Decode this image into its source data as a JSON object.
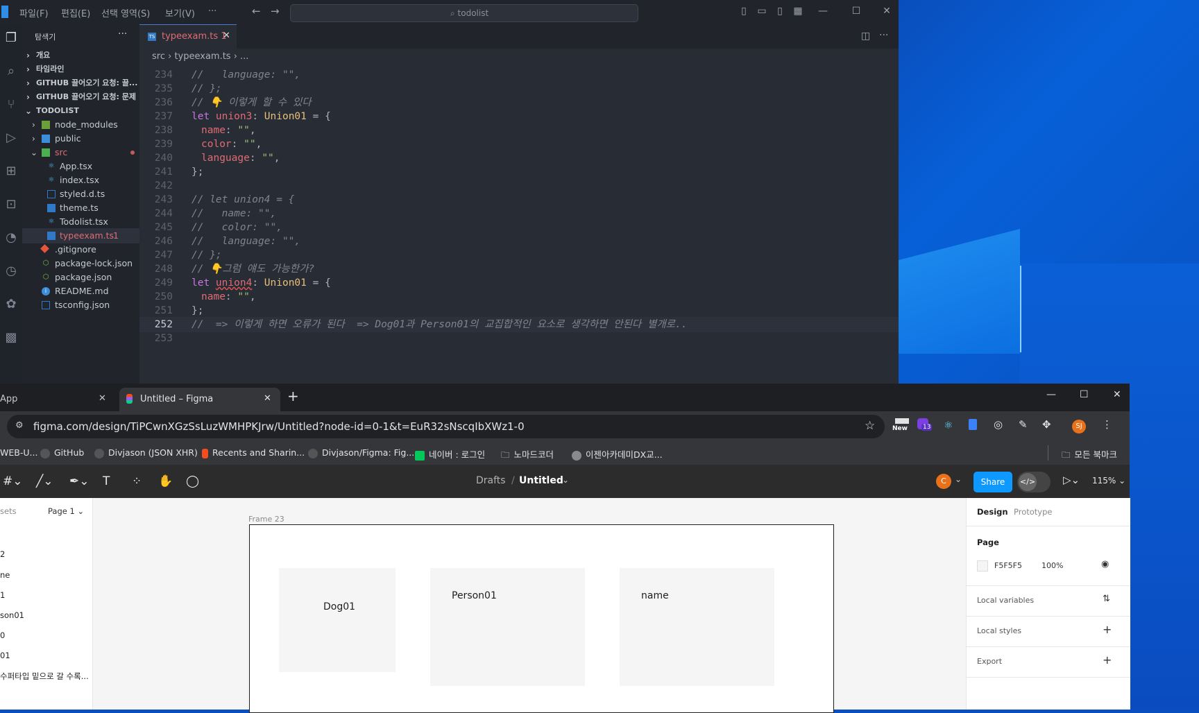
{
  "vscode": {
    "menu": [
      "파일(F)",
      "편집(E)",
      "선택 영역(S)",
      "보기(V)",
      "···"
    ],
    "search": "todolist",
    "explorer_title": "탐색기",
    "sidebar_items": [
      {
        "label": "개요"
      },
      {
        "label": "타임라인"
      },
      {
        "label": "GITHUB 끌어오기 요청: 끌..."
      },
      {
        "label": "GITHUB 끌어오기 요청: 문제"
      },
      {
        "label": "TODOLIST"
      },
      {
        "label": "node_modules"
      },
      {
        "label": "public"
      },
      {
        "label": "src"
      },
      {
        "label": "App.tsx"
      },
      {
        "label": "index.tsx"
      },
      {
        "label": "styled.d.ts"
      },
      {
        "label": "theme.ts"
      },
      {
        "label": "Todolist.tsx"
      },
      {
        "label": "typeexam.ts",
        "badge": "1"
      },
      {
        "label": ".gitignore"
      },
      {
        "label": "package-lock.json"
      },
      {
        "label": "package.json"
      },
      {
        "label": "README.md"
      },
      {
        "label": "tsconfig.json"
      }
    ],
    "tab": {
      "label": "typeexam.ts 1",
      "close": "✕"
    },
    "breadcrumb": "src  ›  typeexam.ts  ›  ...",
    "lines": [
      {
        "n": "234",
        "text": "//   language: \"\","
      },
      {
        "n": "235",
        "text": "// };"
      },
      {
        "n": "236",
        "text": "// 👇 이렇게 할 수 있다"
      },
      {
        "n": "237",
        "k": "let ",
        "v": "union3",
        "p": ": ",
        "t": "Union01",
        "r": " = {"
      },
      {
        "n": "238",
        "prop": "name",
        "sep": ": ",
        "s": "\"\"",
        "e": ","
      },
      {
        "n": "239",
        "prop": "color",
        "sep": ": ",
        "s": "\"\"",
        "e": ","
      },
      {
        "n": "240",
        "prop": "language",
        "sep": ": ",
        "s": "\"\"",
        "e": ","
      },
      {
        "n": "241",
        "plain": "};"
      },
      {
        "n": "242",
        "plain": ""
      },
      {
        "n": "243",
        "text": "// let union4 = {"
      },
      {
        "n": "244",
        "text": "//   name: \"\","
      },
      {
        "n": "245",
        "text": "//   color: \"\","
      },
      {
        "n": "246",
        "text": "//   language: \"\","
      },
      {
        "n": "247",
        "text": "// };"
      },
      {
        "n": "248",
        "text": "// 👇그럼 얘도 가능한가?"
      },
      {
        "n": "249",
        "k": "let ",
        "v": "union4",
        "p": ": ",
        "t": "Union01",
        "r": " = {"
      },
      {
        "n": "250",
        "prop": "name",
        "sep": ": ",
        "s": "\"\"",
        "e": ","
      },
      {
        "n": "251",
        "plain": "};"
      },
      {
        "n": "252",
        "text": "//  => 이렇게 하면 오류가 된다  => Dog01과 Person01의 교집합적인 요소로 생각하면 안된다 별개로.."
      },
      {
        "n": "253",
        "plain": ""
      }
    ]
  },
  "chrome": {
    "tab1": {
      "label": "App",
      "close": "✕"
    },
    "tab2": {
      "label": "Untitled – Figma",
      "close": "✕"
    },
    "new_tab": "+",
    "url": "figma.com/design/TiPCwnXGzSsLuzWMHPKJrw/Untitled?node-id=0-1&t=EuR32sNscqIbXWz1-0",
    "ext_new": "New",
    "ext_badge": "13",
    "profile": "SJ",
    "bookmarks": [
      {
        "label": "WEB-U..."
      },
      {
        "label": "GitHub"
      },
      {
        "label": "Divjason (JSON XHR)"
      },
      {
        "label": "Recents and Sharin..."
      },
      {
        "label": "Divjason/Figma: Fig..."
      },
      {
        "label": "네이버 : 로그인"
      },
      {
        "label": "노마드코더"
      },
      {
        "label": "이젠아카데미DX교..."
      }
    ],
    "all_bookmarks": "모든 북마크"
  },
  "figma": {
    "breadcrumb_drafts": "Drafts",
    "breadcrumb_sep": "/",
    "file_title": "Untitled",
    "avatar": "C",
    "share": "Share",
    "zoom": "115%",
    "left_tab": "sets",
    "page_selector": "Page 1",
    "layers": [
      "2",
      "ne",
      "1",
      "son01",
      "0",
      "01",
      "수퍼타입 밑으로 갈 수록..."
    ],
    "frame_label": "Frame 23",
    "cards": [
      "Dog01",
      "Person01",
      "name"
    ],
    "right": {
      "tab_design": "Design",
      "tab_prototype": "Prototype",
      "page_heading": "Page",
      "page_color": "F5F5F5",
      "page_opacity": "100%",
      "local_variables": "Local variables",
      "local_styles": "Local styles",
      "export": "Export"
    }
  }
}
